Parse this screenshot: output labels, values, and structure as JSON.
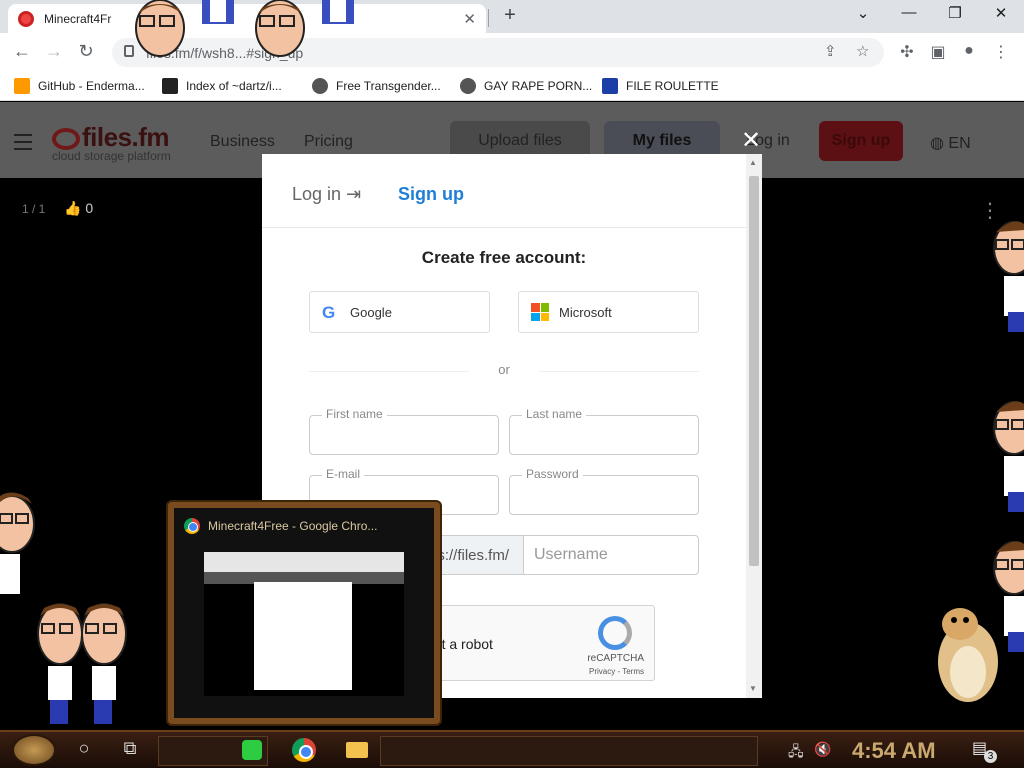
{
  "browser": {
    "tab_title": "Minecraft4Fr",
    "new_tab": "+",
    "url": "files.fm/f/wsh8...#sign_up",
    "bookmarks": [
      {
        "label": "GitHub - Enderma...",
        "icon": "ph-icon",
        "color": "#f90"
      },
      {
        "label": "Index of ~dartz/i...",
        "icon": "tile-icon",
        "color": "#222"
      },
      {
        "label": "Free Transgender...",
        "icon": "person-icon",
        "color": "#555"
      },
      {
        "label": "GAY RAPE PORN...",
        "icon": "globe-icon",
        "color": "#555"
      },
      {
        "label": "FILE ROULETTE",
        "icon": "mft-icon",
        "color": "#1b3fa6"
      }
    ]
  },
  "site": {
    "logo": "files.fm",
    "tagline": "cloud storage platform",
    "nav": [
      "Business",
      "Pricing"
    ],
    "upload_label": "Upload files",
    "myfiles_label": "My files",
    "login_label": "Log in",
    "signup_label": "Sign up",
    "lang": "EN",
    "counter": "1 / 1",
    "likes": "0",
    "accent": "#a8161e"
  },
  "modal": {
    "tab_login": "Log in",
    "tab_signup": "Sign up",
    "title": "Create free account:",
    "google": "Google",
    "microsoft": "Microsoft",
    "or": "or",
    "first_name": "First name",
    "last_name": "Last name",
    "email": "E-mail",
    "password": "Password",
    "url_prefix": "s://files.fm/",
    "username_placeholder": "Username",
    "captcha_text": "not a robot",
    "recaptcha": "reCAPTCHA",
    "recaptcha_links": "Privacy - Terms",
    "accent": "#1f7fd6"
  },
  "preview": {
    "title": "Minecraft4Free - Google Chro..."
  },
  "taskbar": {
    "clock": "4:54 AM",
    "notif_count": "3"
  }
}
